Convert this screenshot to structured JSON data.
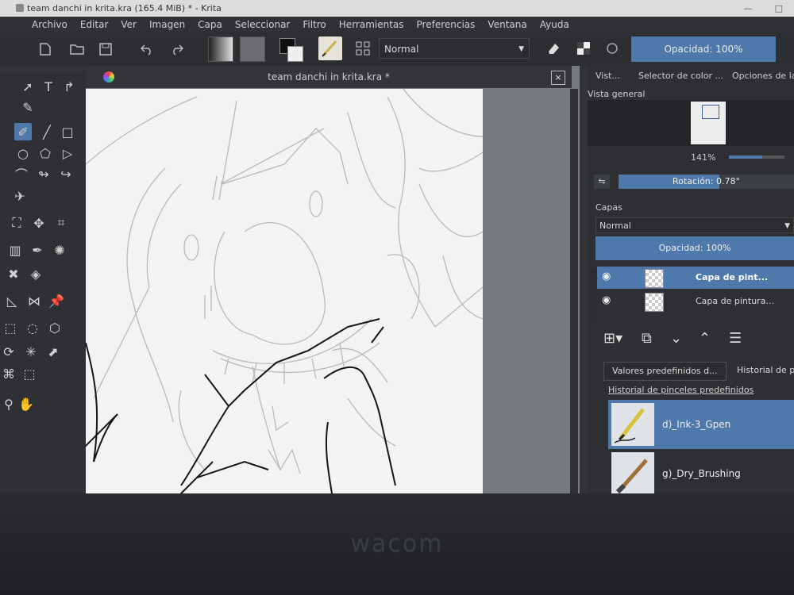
{
  "window": {
    "title": "team danchi in krita.kra (165.4 MiB)  * - Krita",
    "controls": [
      "—",
      "□"
    ]
  },
  "menubar": {
    "items": [
      "Archivo",
      "Editar",
      "Ver",
      "Imagen",
      "Capa",
      "Seleccionar",
      "Filtro",
      "Herramientas",
      "Preferencias",
      "Ventana",
      "Ayuda"
    ]
  },
  "toolbar": {
    "blend_mode": "Normal",
    "opacity_label": "Opacidad:  100%"
  },
  "document_tab": {
    "title": "team danchi in krita.kra *",
    "close": "×"
  },
  "docker": {
    "tabs": [
      "Vist...",
      "Selector de color ...",
      "Opciones de la h"
    ],
    "overview_label": "Vista general",
    "zoom_label": "141%",
    "rotation_label": "Rotación: 0.78°",
    "layers_title": "Capas",
    "layer_blend_mode": "Normal",
    "layer_opacity_label": "Opacidad:  100%",
    "layers": [
      {
        "name": "Capa de pint...",
        "selected": true
      },
      {
        "name": "Capa de pintura...",
        "selected": false
      }
    ],
    "preset_tabs": [
      "Valores predefinidos d...",
      "Historial de pin"
    ],
    "preset_history_title": "Historial de pinceles predefinidos",
    "presets": [
      {
        "name": "d)_Ink-3_Gpen",
        "selected": true
      },
      {
        "name": "g)_Dry_Brushing",
        "selected": false
      }
    ]
  },
  "device": {
    "brand": "wacom"
  },
  "colors": {
    "accent": "#4f79ab",
    "panel": "#2d2f32",
    "canvas_paper": "#f3f3f3",
    "sketch": "#b9b9b9",
    "ink": "#151515"
  }
}
